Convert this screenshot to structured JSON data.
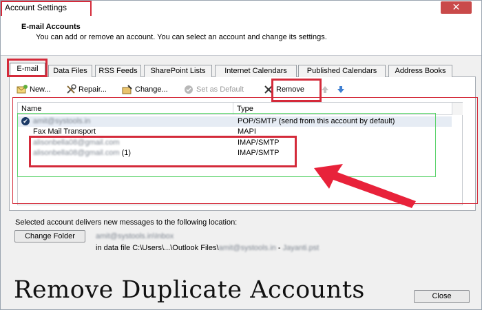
{
  "window": {
    "title": "Account Settings",
    "close_glyph": "✕"
  },
  "header": {
    "title": "E-mail Accounts",
    "description": "You can add or remove an account. You can select an account and change its settings."
  },
  "tabs": [
    {
      "label": "E-mail",
      "active": true
    },
    {
      "label": "Data Files"
    },
    {
      "label": "RSS Feeds"
    },
    {
      "label": "SharePoint Lists"
    },
    {
      "label": "Internet Calendars"
    },
    {
      "label": "Published Calendars"
    },
    {
      "label": "Address Books"
    }
  ],
  "toolbar": {
    "new_label": "New...",
    "repair_label": "Repair...",
    "change_label": "Change...",
    "set_default_label": "Set as Default",
    "remove_label": "Remove",
    "up_icon": "arrow-up-icon",
    "down_icon": "arrow-down-icon"
  },
  "list": {
    "headers": {
      "name": "Name",
      "type": "Type"
    },
    "rows": [
      {
        "name": "amit@systools.in",
        "type": "POP/SMTP (send from this account by default)",
        "default": true,
        "blurred": true
      },
      {
        "name": "Fax Mail Transport",
        "type": "MAPI",
        "blurred": false
      },
      {
        "name": "alisonbella08@gmail.com",
        "type": "IMAP/SMTP",
        "blurred": true
      },
      {
        "name": "alisonbella08@gmail.com",
        "suffix": "(1)",
        "type": "IMAP/SMTP",
        "blurred": true
      }
    ]
  },
  "delivery": {
    "label": "Selected account delivers new messages to the following location:",
    "change_folder_label": "Change Folder",
    "inbox_path": "amit@systools.in\\Inbox",
    "data_file_prefix": "in data file C:\\Users\\...\\Outlook Files\\",
    "data_file_blur": "amit@systools.in",
    "data_file_mid": " - ",
    "data_file_tail_blur": "Jayanti.pst"
  },
  "caption": "Remove Duplicate Accounts",
  "close_button_label": "Close",
  "colors": {
    "highlight_red": "#d42a3a",
    "highlight_green": "#5bd36b"
  }
}
